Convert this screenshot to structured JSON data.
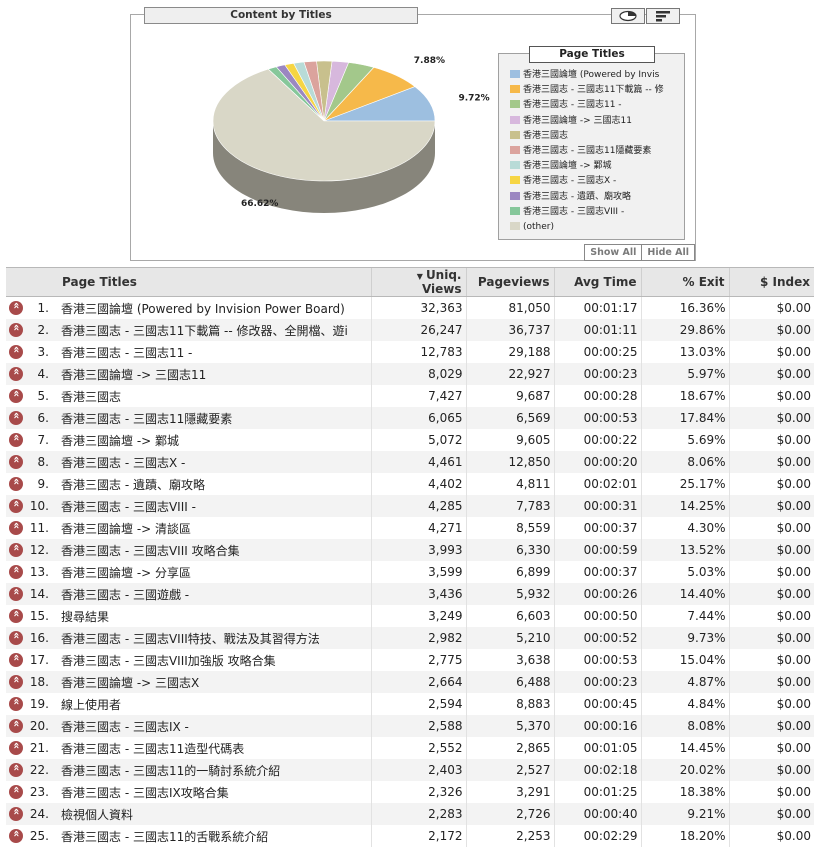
{
  "chart": {
    "title": "Content by Titles",
    "legend_title": "Page Titles",
    "show_all": "Show All",
    "hide_all": "Hide All",
    "toggle_pie_icon": "pie-view-icon",
    "toggle_bar_icon": "bar-view-icon"
  },
  "chart_data": {
    "type": "pie",
    "title": "Content by Titles",
    "legend_position": "right",
    "slice_labels": [
      "9.72%",
      "7.88%",
      "66.62%"
    ],
    "slices": [
      {
        "name": "香港三國論壇 (Powered by Invis",
        "value": 9.72,
        "color": "#9dbfe0"
      },
      {
        "name": "香港三國志 - 三國志11下載篇 -- 修",
        "value": 7.88,
        "color": "#f6b94a"
      },
      {
        "name": "香港三國志 - 三國志11 -",
        "value": 3.84,
        "color": "#a3c88b"
      },
      {
        "name": "香港三國論壇 -> 三國志11",
        "value": 2.41,
        "color": "#d7b8dd"
      },
      {
        "name": "香港三國志",
        "value": 2.23,
        "color": "#c8c08d"
      },
      {
        "name": "香港三國志 - 三國志11隱藏要素",
        "value": 1.82,
        "color": "#dba39d"
      },
      {
        "name": "香港三國論壇 -> 鄴城",
        "value": 1.52,
        "color": "#b8dbd7"
      },
      {
        "name": "香港三國志 - 三國志X -",
        "value": 1.34,
        "color": "#f6d543"
      },
      {
        "name": "香港三國志 - 遺蹟、廟攻略",
        "value": 1.32,
        "color": "#9b87c1"
      },
      {
        "name": "香港三國志 - 三國志VIII -",
        "value": 1.3,
        "color": "#86c79a"
      },
      {
        "name": "(other)",
        "value": 66.62,
        "color": "#d9d7c7"
      }
    ]
  },
  "table": {
    "columns": {
      "title": "Page Titles",
      "uniq_views": "Uniq. Views",
      "pageviews": "Pageviews",
      "avg_time": "Avg Time",
      "exit": "% Exit",
      "index": "$ Index"
    },
    "sort_icon": "sort-desc-icon",
    "rows": [
      {
        "rank": "1.",
        "title": "香港三國論壇 (Powered by Invision Power Board)",
        "uniq": "32,363",
        "pv": "81,050",
        "time": "00:01:17",
        "exit": "16.36%",
        "index": "$0.00"
      },
      {
        "rank": "2.",
        "title": "香港三國志 - 三國志11下載篇 -- 修改器、全開檔、遊i",
        "uniq": "26,247",
        "pv": "36,737",
        "time": "00:01:11",
        "exit": "29.86%",
        "index": "$0.00"
      },
      {
        "rank": "3.",
        "title": "香港三國志 - 三國志11 -",
        "uniq": "12,783",
        "pv": "29,188",
        "time": "00:00:25",
        "exit": "13.03%",
        "index": "$0.00"
      },
      {
        "rank": "4.",
        "title": "香港三國論壇 -> 三國志11",
        "uniq": "8,029",
        "pv": "22,927",
        "time": "00:00:23",
        "exit": "5.97%",
        "index": "$0.00"
      },
      {
        "rank": "5.",
        "title": "香港三國志",
        "uniq": "7,427",
        "pv": "9,687",
        "time": "00:00:28",
        "exit": "18.67%",
        "index": "$0.00"
      },
      {
        "rank": "6.",
        "title": "香港三國志 - 三國志11隱藏要素",
        "uniq": "6,065",
        "pv": "6,569",
        "time": "00:00:53",
        "exit": "17.84%",
        "index": "$0.00"
      },
      {
        "rank": "7.",
        "title": "香港三國論壇 -> 鄴城",
        "uniq": "5,072",
        "pv": "9,605",
        "time": "00:00:22",
        "exit": "5.69%",
        "index": "$0.00"
      },
      {
        "rank": "8.",
        "title": "香港三國志 - 三國志X -",
        "uniq": "4,461",
        "pv": "12,850",
        "time": "00:00:20",
        "exit": "8.06%",
        "index": "$0.00"
      },
      {
        "rank": "9.",
        "title": "香港三國志 - 遺蹟、廟攻略",
        "uniq": "4,402",
        "pv": "4,811",
        "time": "00:02:01",
        "exit": "25.17%",
        "index": "$0.00"
      },
      {
        "rank": "10.",
        "title": "香港三國志 - 三國志VIII -",
        "uniq": "4,285",
        "pv": "7,783",
        "time": "00:00:31",
        "exit": "14.25%",
        "index": "$0.00"
      },
      {
        "rank": "11.",
        "title": "香港三國論壇 -> 清談區",
        "uniq": "4,271",
        "pv": "8,559",
        "time": "00:00:37",
        "exit": "4.30%",
        "index": "$0.00"
      },
      {
        "rank": "12.",
        "title": "香港三國志 - 三國志VIII 攻略合集",
        "uniq": "3,993",
        "pv": "6,330",
        "time": "00:00:59",
        "exit": "13.52%",
        "index": "$0.00"
      },
      {
        "rank": "13.",
        "title": "香港三國論壇 -> 分享區",
        "uniq": "3,599",
        "pv": "6,899",
        "time": "00:00:37",
        "exit": "5.03%",
        "index": "$0.00"
      },
      {
        "rank": "14.",
        "title": "香港三國志 - 三國遊戲 -",
        "uniq": "3,436",
        "pv": "5,932",
        "time": "00:00:26",
        "exit": "14.40%",
        "index": "$0.00"
      },
      {
        "rank": "15.",
        "title": "搜尋結果",
        "uniq": "3,249",
        "pv": "6,603",
        "time": "00:00:50",
        "exit": "7.44%",
        "index": "$0.00"
      },
      {
        "rank": "16.",
        "title": "香港三國志 - 三國志VIII特技、戰法及其習得方法",
        "uniq": "2,982",
        "pv": "5,210",
        "time": "00:00:52",
        "exit": "9.73%",
        "index": "$0.00"
      },
      {
        "rank": "17.",
        "title": "香港三國志 - 三國志VIII加強版 攻略合集",
        "uniq": "2,775",
        "pv": "3,638",
        "time": "00:00:53",
        "exit": "15.04%",
        "index": "$0.00"
      },
      {
        "rank": "18.",
        "title": "香港三國論壇 -> 三國志X",
        "uniq": "2,664",
        "pv": "6,488",
        "time": "00:00:23",
        "exit": "4.87%",
        "index": "$0.00"
      },
      {
        "rank": "19.",
        "title": "線上使用者",
        "uniq": "2,594",
        "pv": "8,883",
        "time": "00:00:45",
        "exit": "4.84%",
        "index": "$0.00"
      },
      {
        "rank": "20.",
        "title": "香港三國志 - 三國志IX -",
        "uniq": "2,588",
        "pv": "5,370",
        "time": "00:00:16",
        "exit": "8.08%",
        "index": "$0.00"
      },
      {
        "rank": "21.",
        "title": "香港三國志 - 三國志11造型代碼表",
        "uniq": "2,552",
        "pv": "2,865",
        "time": "00:01:05",
        "exit": "14.45%",
        "index": "$0.00"
      },
      {
        "rank": "22.",
        "title": "香港三國志 - 三國志11的一騎討系統介紹",
        "uniq": "2,403",
        "pv": "2,527",
        "time": "00:02:18",
        "exit": "20.02%",
        "index": "$0.00"
      },
      {
        "rank": "23.",
        "title": "香港三國志 - 三國志IX攻略合集",
        "uniq": "2,326",
        "pv": "3,291",
        "time": "00:01:25",
        "exit": "18.38%",
        "index": "$0.00"
      },
      {
        "rank": "24.",
        "title": "檢視個人資料",
        "uniq": "2,283",
        "pv": "2,726",
        "time": "00:00:40",
        "exit": "9.21%",
        "index": "$0.00"
      },
      {
        "rank": "25.",
        "title": "香港三國志 - 三國志11的舌戰系統介紹",
        "uniq": "2,172",
        "pv": "2,253",
        "time": "00:02:29",
        "exit": "18.20%",
        "index": "$0.00"
      }
    ]
  }
}
